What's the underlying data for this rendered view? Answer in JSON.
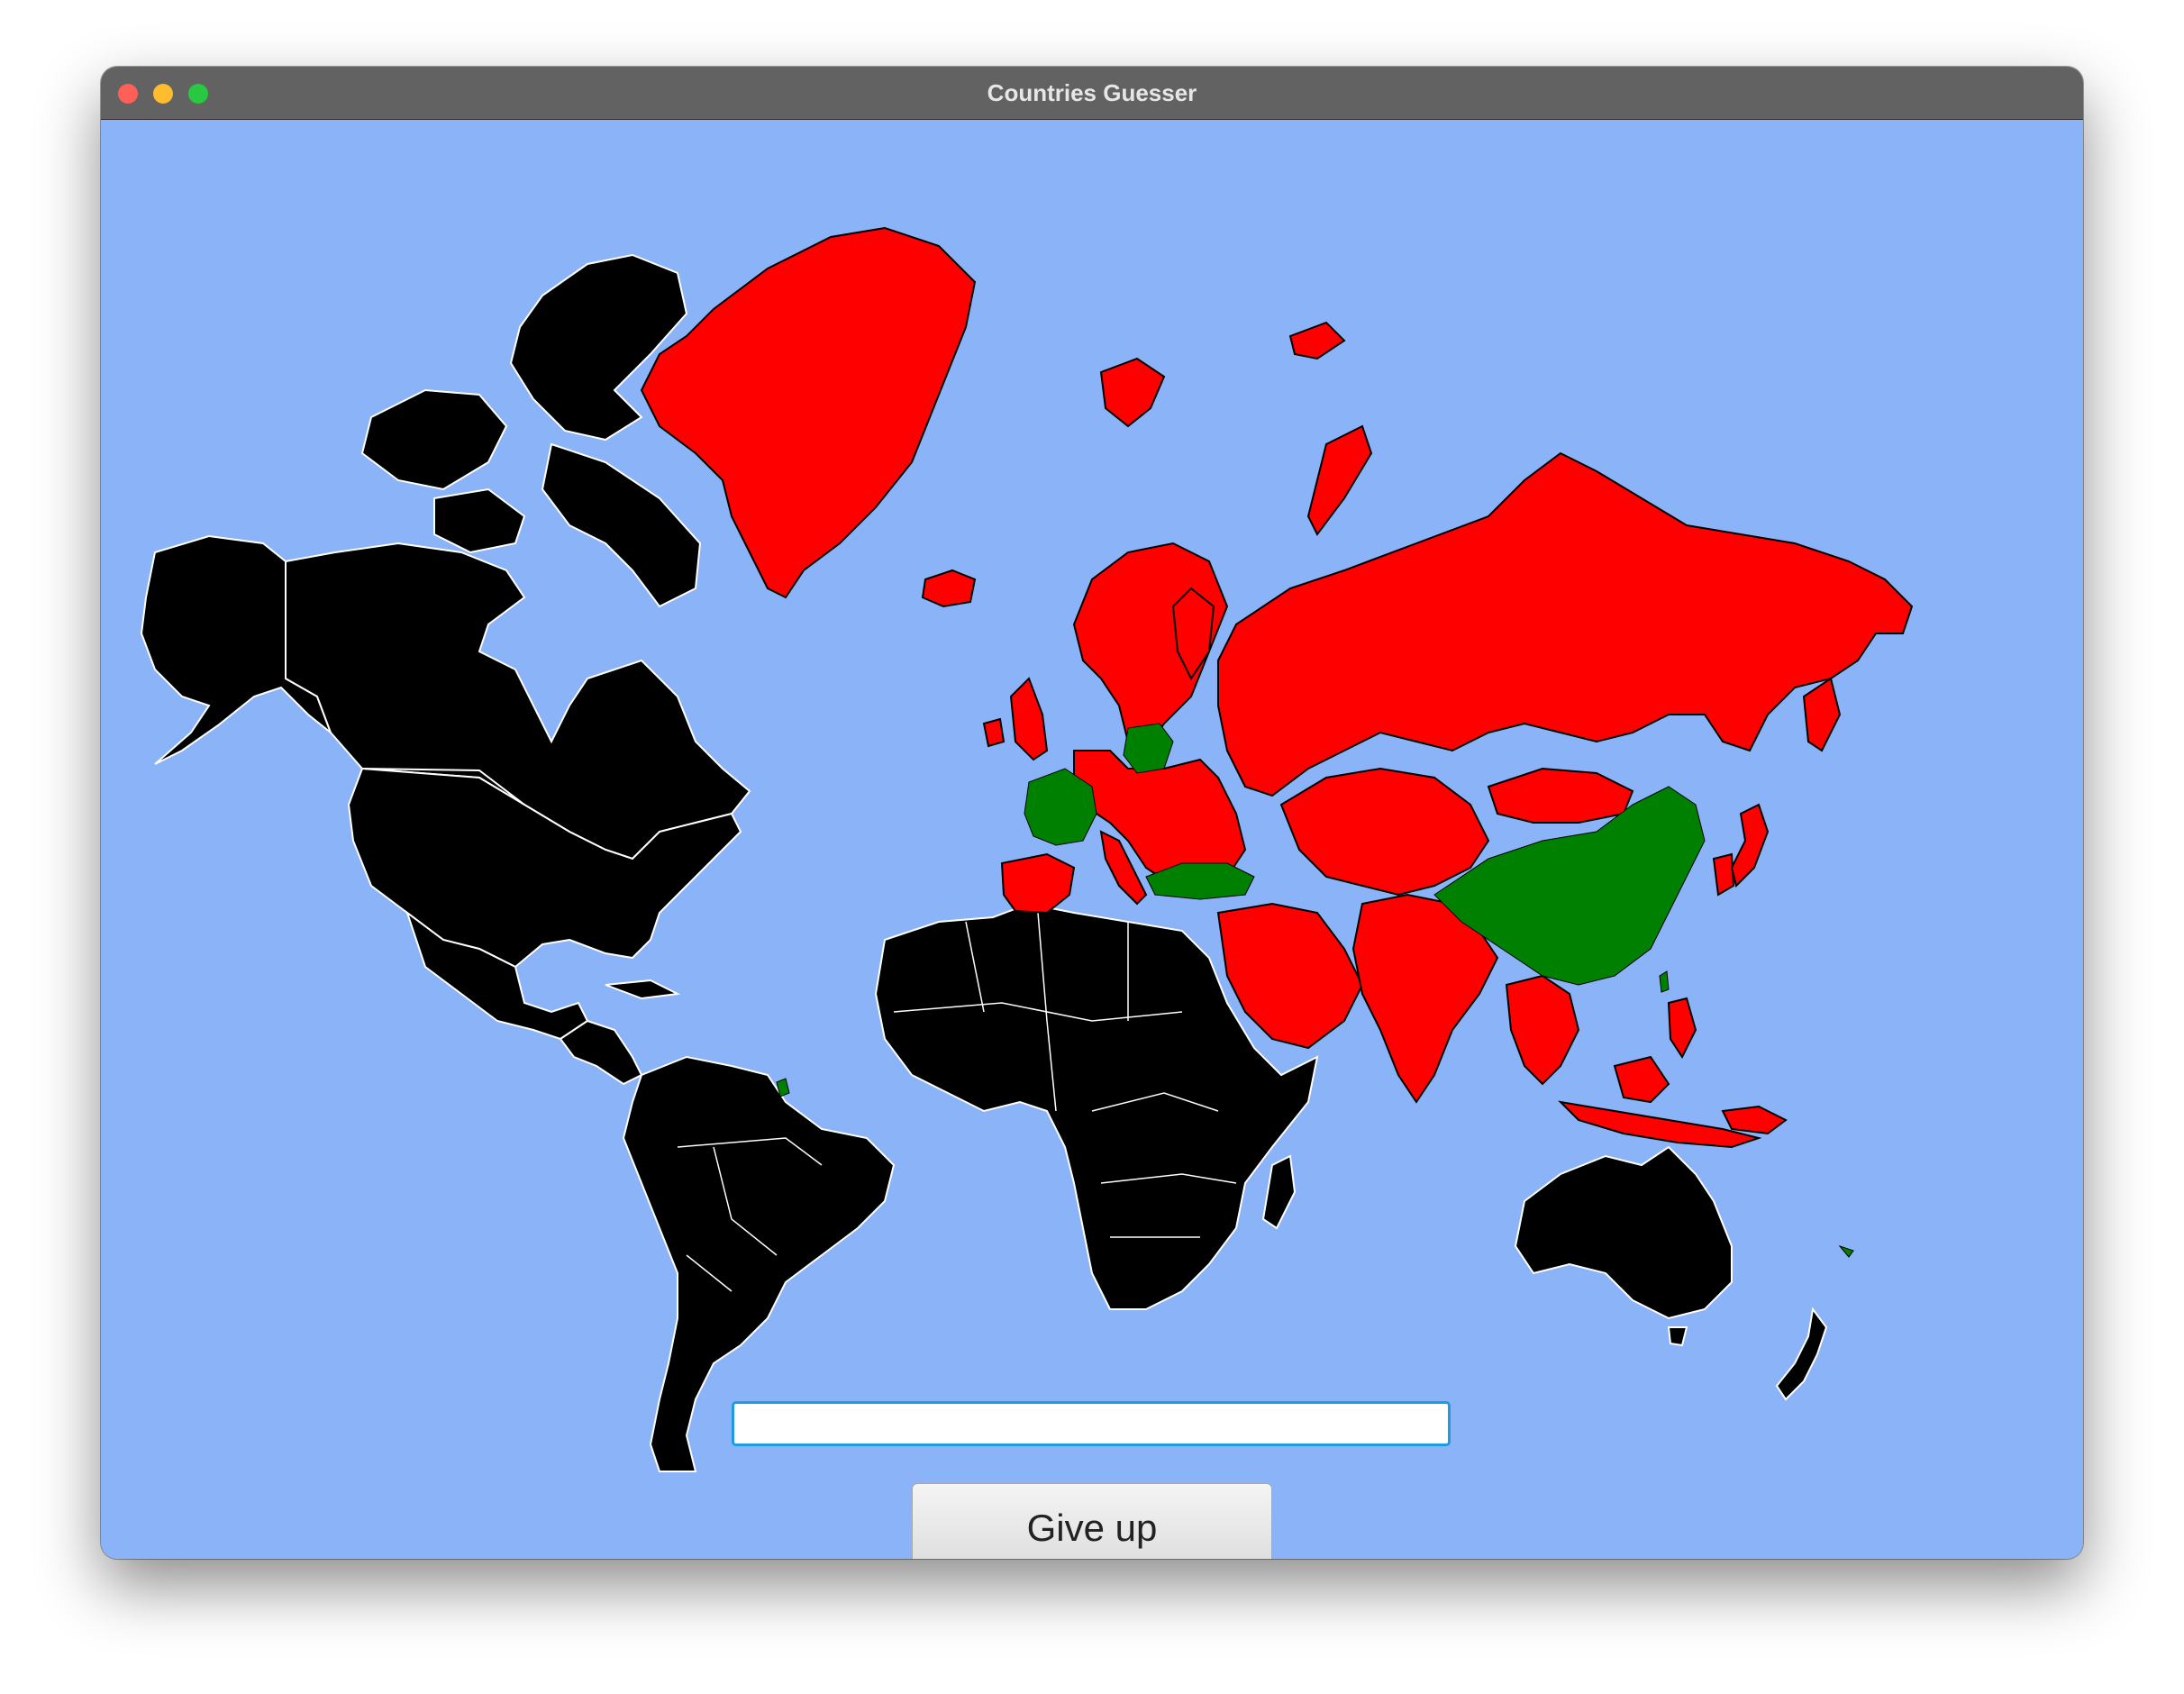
{
  "window": {
    "title": "Countries Guesser"
  },
  "colors": {
    "ocean": "#8bb3f7",
    "unguessed": "#000000",
    "revealed": "#ff0000",
    "guessed": "#008000",
    "border_unguessed": "#ffffff",
    "border_revealed": "#000000"
  },
  "guess_input": {
    "value": "",
    "placeholder": ""
  },
  "give_up_button": {
    "label": "Give up"
  }
}
